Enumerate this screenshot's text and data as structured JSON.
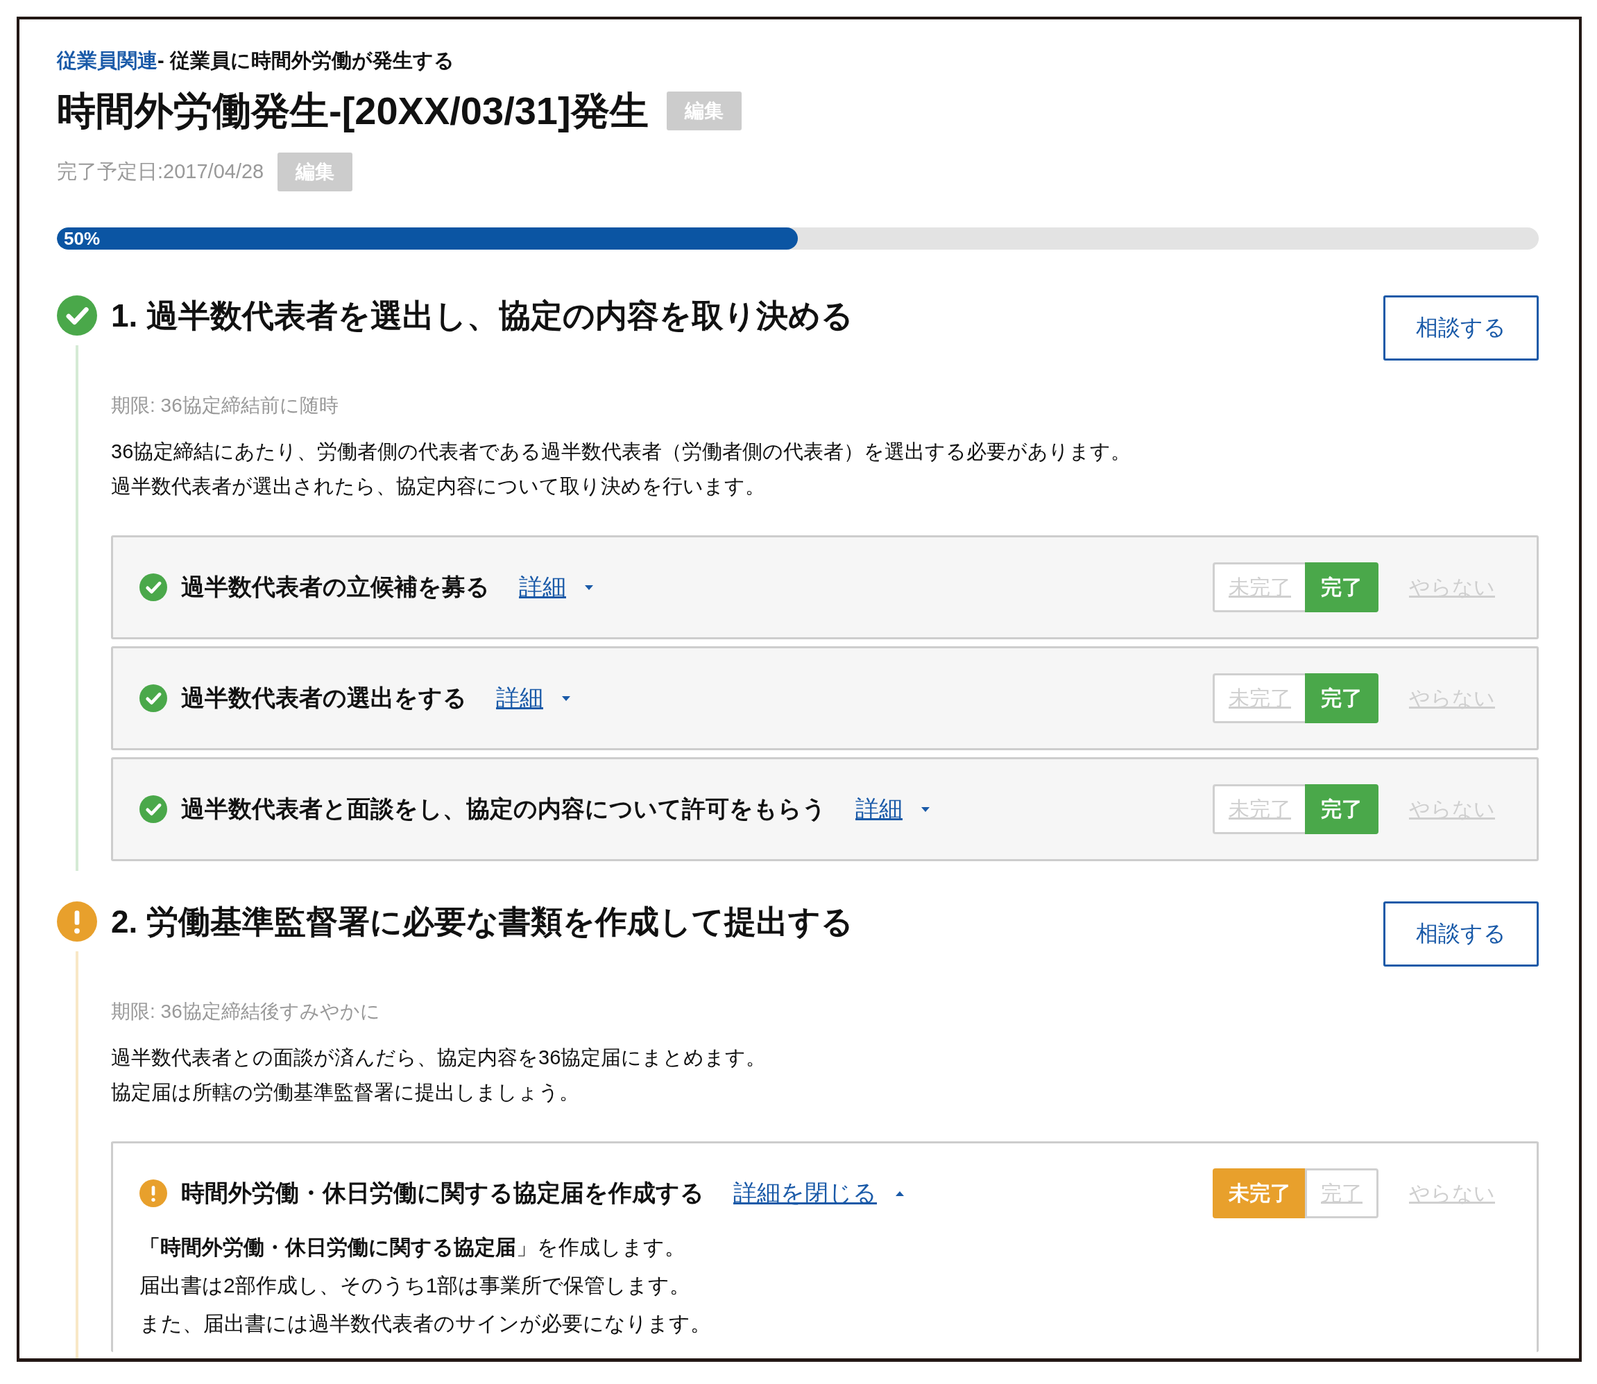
{
  "breadcrumb": {
    "category": "従業員関連",
    "title": "- 従業員に時間外労働が発生する"
  },
  "title": "時間外労働発生-[20XX/03/31]発生",
  "title_edit": "編集",
  "due_date": "完了予定日:2017/04/28",
  "due_edit": "編集",
  "progress": {
    "level": 0.5,
    "label": "50%"
  },
  "steps": [
    {
      "done": true,
      "title": "1. 過半数代表者を選出し、協定の内容を取り決める",
      "consult": "相談する",
      "deadline": "期限: 36協定締結前に随時",
      "description": [
        "36協定締結にあたり、労働者側の代表者である過半数代表者（労働者側の代表者）を選出する必要があります。",
        "過半数代表者が選出されたら、協定内容について取り決めを行います。"
      ],
      "tasks": [
        {
          "done": true,
          "title": "過半数代表者の立候補を募る",
          "details": "詳細",
          "expanded": false,
          "options": [
            {
              "label": "未完了",
              "selected": false
            },
            {
              "label": "完了",
              "selected": true
            }
          ],
          "skip": "やらない"
        },
        {
          "done": true,
          "title": "過半数代表者の選出をする",
          "details": "詳細",
          "expanded": false,
          "options": [
            {
              "label": "未完了",
              "selected": false
            },
            {
              "label": "完了",
              "selected": true
            }
          ],
          "skip": "やらない"
        },
        {
          "done": true,
          "title": "過半数代表者と面談をし、協定の内容について許可をもらう",
          "details": "詳細",
          "expanded": false,
          "options": [
            {
              "label": "未完了",
              "selected": false
            },
            {
              "label": "完了",
              "selected": true
            }
          ],
          "skip": "やらない"
        }
      ]
    },
    {
      "done": false,
      "title": "2. 労働基準監督署に必要な書類を作成して提出する",
      "consult": "相談する",
      "deadline": "期限: 36協定締結後すみやかに",
      "description": [
        "過半数代表者との面談が済んだら、協定内容を36協定届にまとめます。",
        "協定届は所轄の労働基準監督署に提出しましょう。"
      ],
      "tasks": [
        {
          "done": false,
          "title": "時間外労働・休日労働に関する協定届を作成する",
          "details": "詳細を閉じる",
          "expanded": true,
          "options": [
            {
              "label": "未完了",
              "selected": true
            },
            {
              "label": "完了",
              "selected": false
            }
          ],
          "skip": "やらない",
          "body": [
            "**「時間外労働・休日労働に関する協定届**」を作成します。",
            "届出書は2部作成し、そのうち1部は事業所で保管します。",
            "また、届出書には過半数代表者のサインが必要になります。"
          ]
        }
      ]
    }
  ]
}
